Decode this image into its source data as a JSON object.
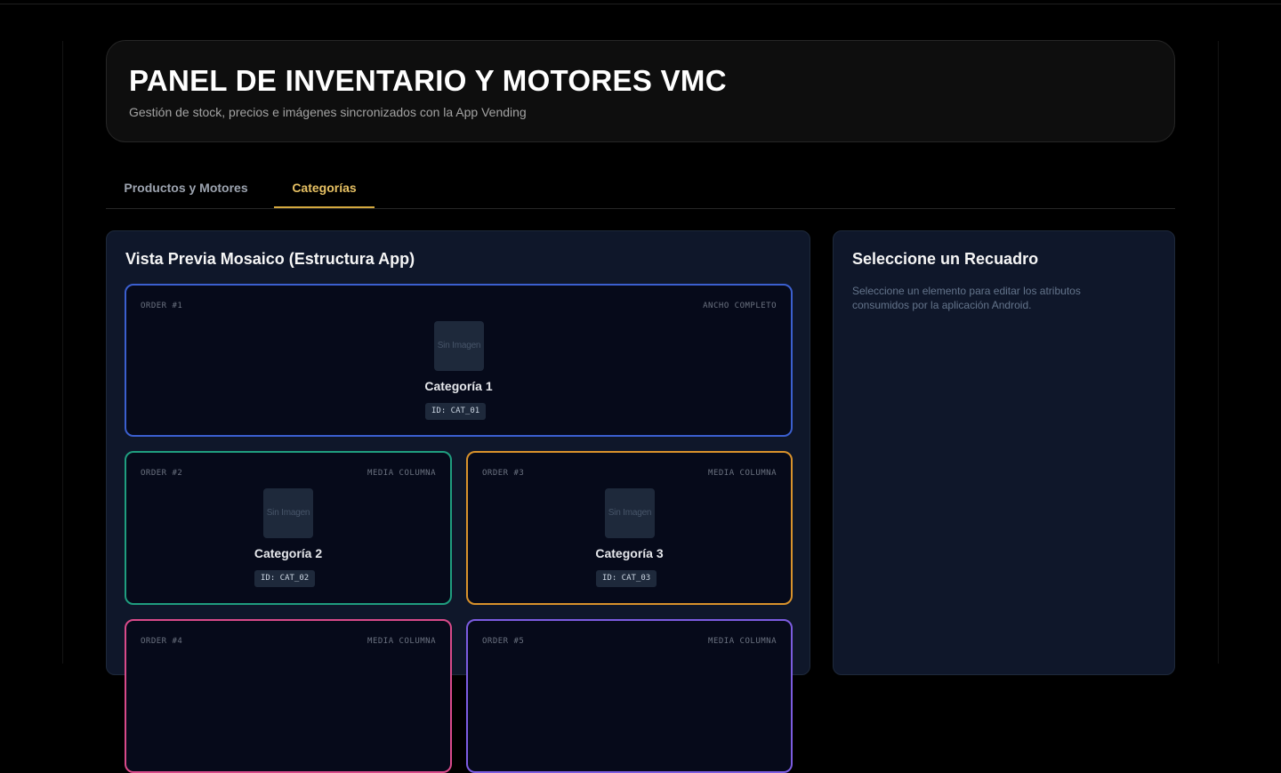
{
  "header": {
    "title": "PANEL DE INVENTARIO Y MOTORES VMC",
    "subtitle": "Gestión de stock, precios e imágenes sincronizados con la App Vending"
  },
  "tabs": [
    {
      "label": "Productos y Motores",
      "active": false
    },
    {
      "label": "Categorías",
      "active": true
    }
  ],
  "preview": {
    "title": "Vista Previa Mosaico (Estructura App)",
    "tiles": [
      {
        "order": "ORDER #1",
        "size": "ANCHO COMPLETO",
        "image": "Sin Imagen",
        "name": "Categoría 1",
        "id": "ID: CAT_01",
        "color": "#3b5fcf"
      },
      {
        "order": "ORDER #2",
        "size": "MEDIA COLUMNA",
        "image": "Sin Imagen",
        "name": "Categoría 2",
        "id": "ID: CAT_02",
        "color": "#1f9e7f"
      },
      {
        "order": "ORDER #3",
        "size": "MEDIA COLUMNA",
        "image": "Sin Imagen",
        "name": "Categoría 3",
        "id": "ID: CAT_03",
        "color": "#d9922b"
      },
      {
        "order": "ORDER #4",
        "size": "MEDIA COLUMNA",
        "image": "",
        "name": "",
        "id": "",
        "color": "#d94a8a"
      },
      {
        "order": "ORDER #5",
        "size": "MEDIA COLUMNA",
        "image": "",
        "name": "",
        "id": "",
        "color": "#7c5ce0"
      }
    ]
  },
  "editor": {
    "title": "Seleccione un Recuadro",
    "hint": "Seleccione un elemento para editar los atributos consumidos por la aplicación Android."
  }
}
